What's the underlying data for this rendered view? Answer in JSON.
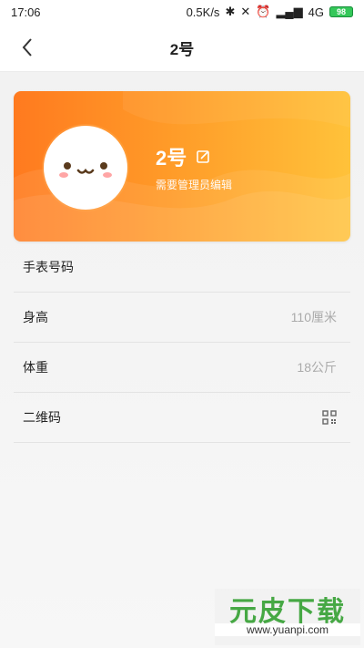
{
  "status_bar": {
    "time": "17:06",
    "speed": "0.5K/s",
    "network": "4G",
    "battery": "98"
  },
  "header": {
    "title": "2号"
  },
  "profile": {
    "name": "2号",
    "subtitle": "需要管理员编辑"
  },
  "list": {
    "watch_number_label": "手表号码",
    "height_label": "身高",
    "height_value": "110厘米",
    "weight_label": "体重",
    "weight_value": "18公斤",
    "qrcode_label": "二维码"
  },
  "watermark": {
    "title": "元皮下载",
    "url": "www.yuanpi.com"
  }
}
